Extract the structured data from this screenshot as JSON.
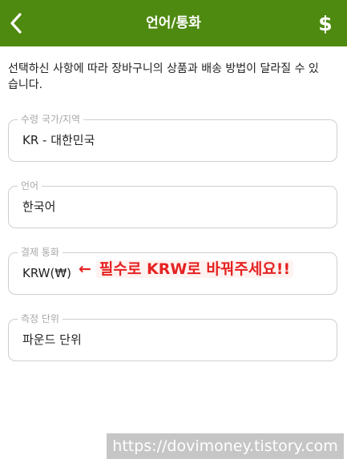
{
  "header": {
    "title": "언어/통화",
    "back_icon": "chevron-left-icon",
    "currency_icon": "dollar-icon",
    "currency_symbol": "$",
    "background_color": "#4f8a10"
  },
  "notice": {
    "text": "선택하신 사항에 따라 장바구니의 상품과 배송 방법이 달라질 수 있습니다."
  },
  "fields": {
    "country": {
      "label": "수령 국가/지역",
      "value": "KR - 대한민국"
    },
    "language": {
      "label": "언어",
      "value": "한국어"
    },
    "currency": {
      "label": "결제 통화",
      "value": "KRW(₩)"
    },
    "unit": {
      "label": "측정 단위",
      "value": "파운드 단위"
    }
  },
  "annotation": {
    "arrow": "←",
    "text": "필수로 KRW로 바꿔주세요!!",
    "color": "#e52222"
  },
  "watermark": {
    "text": "https://dovimoney.tistory.com"
  }
}
